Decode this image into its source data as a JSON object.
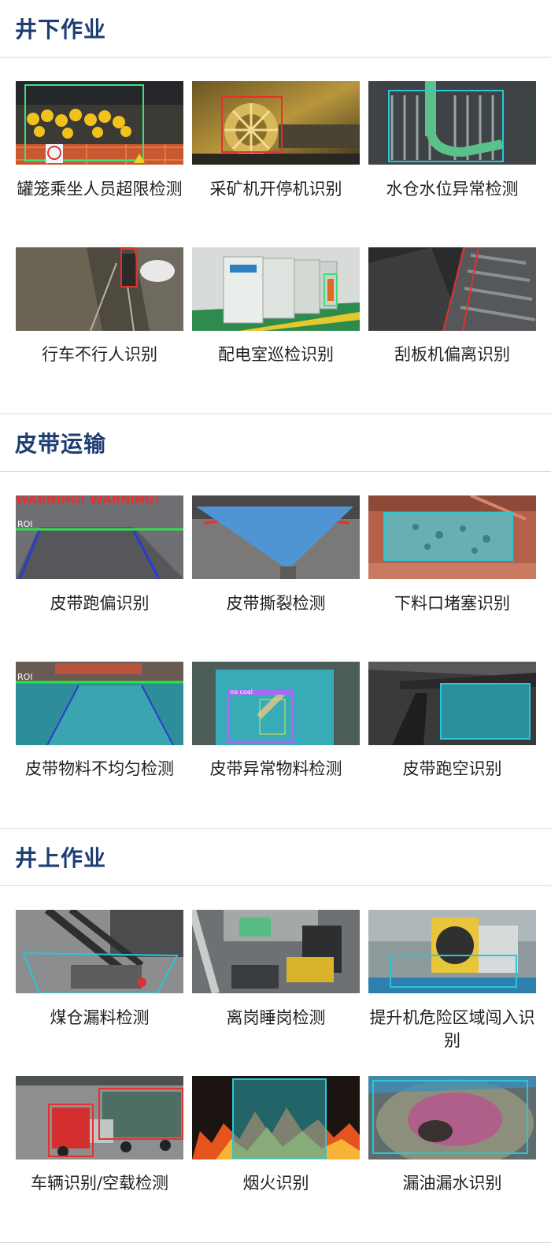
{
  "sections": [
    {
      "title": "井下作业",
      "items": [
        {
          "label": "罐笼乘坐人员超限检测",
          "icon": "cage-miners-image"
        },
        {
          "label": "采矿机开停机识别",
          "icon": "shearer-image"
        },
        {
          "label": "水仓水位异常检测",
          "icon": "sump-water-image"
        },
        {
          "label": "行车不行人识别",
          "icon": "tunnel-track-image"
        },
        {
          "label": "配电室巡检识别",
          "icon": "power-room-image"
        },
        {
          "label": "刮板机偏离识别",
          "icon": "scraper-conveyor-image"
        }
      ]
    },
    {
      "title": "皮带运输",
      "items": [
        {
          "label": "皮带跑偏识别",
          "icon": "belt-deviation-image",
          "overlay_text": "WARNING! WARNING!",
          "roi_text": "ROI"
        },
        {
          "label": "皮带撕裂检测",
          "icon": "belt-tear-image"
        },
        {
          "label": "下料口堵塞识别",
          "icon": "chute-blockage-image"
        },
        {
          "label": "皮带物料不均匀检测",
          "icon": "belt-uneven-image",
          "roi_text": "ROI"
        },
        {
          "label": "皮带异常物料检测",
          "icon": "belt-foreign-object-image",
          "overlay_text": "no coal"
        },
        {
          "label": "皮带跑空识别",
          "icon": "belt-empty-image"
        }
      ]
    },
    {
      "title": "井上作业",
      "items": [
        {
          "label": "煤仓漏料检测",
          "icon": "bunker-leak-image"
        },
        {
          "label": "离岗睡岗检测",
          "icon": "control-room-image"
        },
        {
          "label": "提升机危险区域闯入识别",
          "icon": "hoist-zone-image"
        },
        {
          "label": "车辆识别/空载检测",
          "icon": "truck-image"
        },
        {
          "label": "烟火识别",
          "icon": "fire-image"
        },
        {
          "label": "漏油漏水识别",
          "icon": "oil-leak-image"
        }
      ]
    }
  ],
  "colors": {
    "title": "#1d3d73",
    "divider": "#d9d9d9",
    "detect_box_green": "#3be07a",
    "detect_box_red": "#e53030",
    "detect_box_cyan": "#29c6d6"
  }
}
